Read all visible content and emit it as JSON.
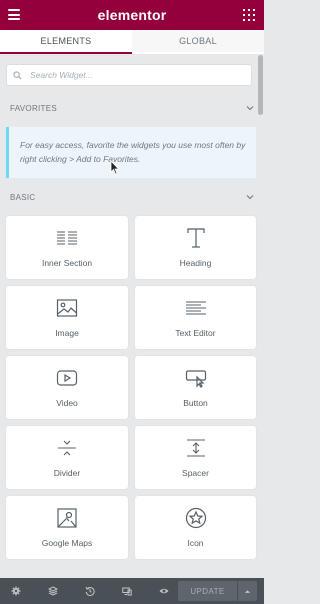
{
  "header": {
    "brand": "elementor"
  },
  "tabs": [
    {
      "label": "ELEMENTS",
      "active": true
    },
    {
      "label": "GLOBAL",
      "active": false
    }
  ],
  "search": {
    "placeholder": "Search Widget..."
  },
  "favorites": {
    "title": "FAVORITES",
    "hint": "For easy access, favorite the widgets you use most often by right clicking > Add to Favorites."
  },
  "basic": {
    "title": "BASIC",
    "widgets": [
      {
        "label": "Inner Section",
        "icon": "inner-section-icon"
      },
      {
        "label": "Heading",
        "icon": "heading-icon"
      },
      {
        "label": "Image",
        "icon": "image-icon"
      },
      {
        "label": "Text Editor",
        "icon": "text-editor-icon"
      },
      {
        "label": "Video",
        "icon": "video-icon"
      },
      {
        "label": "Button",
        "icon": "button-icon"
      },
      {
        "label": "Divider",
        "icon": "divider-icon"
      },
      {
        "label": "Spacer",
        "icon": "spacer-icon"
      },
      {
        "label": "Google Maps",
        "icon": "google-maps-icon"
      },
      {
        "label": "Icon",
        "icon": "star-icon"
      }
    ]
  },
  "footer": {
    "update_label": "UPDATE"
  },
  "colors": {
    "brand": "#93003c",
    "footer": "#495157",
    "hint_border": "#71d7f7"
  }
}
